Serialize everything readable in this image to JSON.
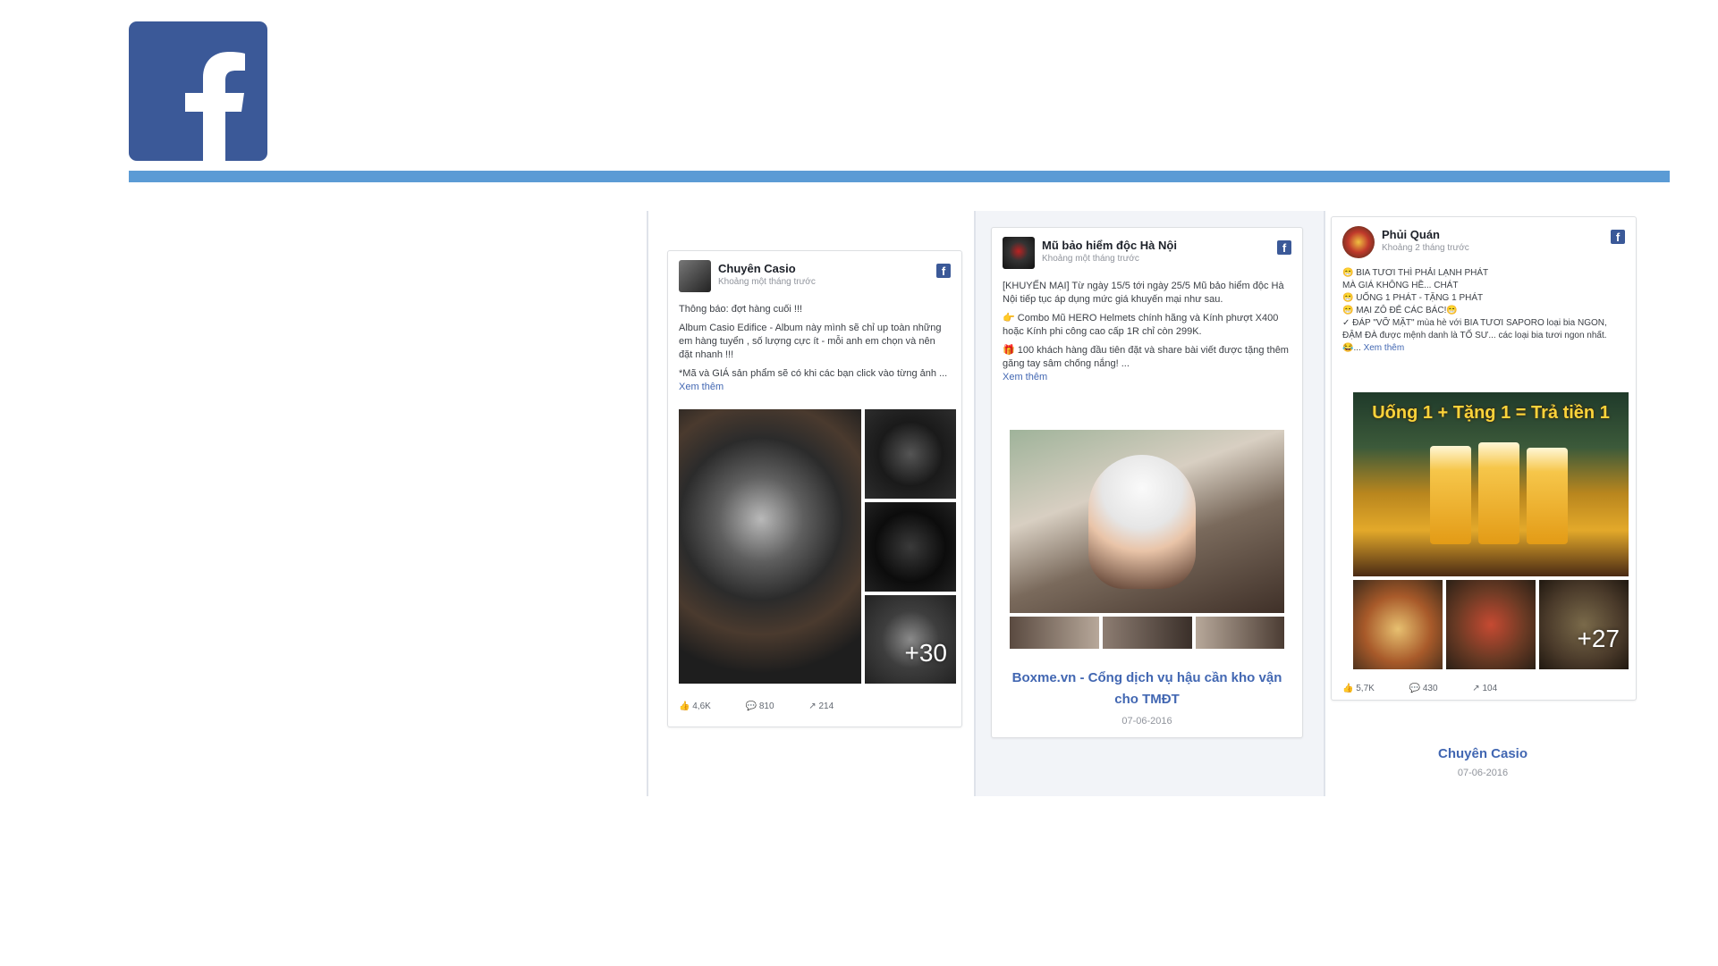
{
  "slide": {
    "logo_letter": "f",
    "colors": {
      "facebook_blue": "#3b5998",
      "rule": "#5b9bd5",
      "link": "#4267b2"
    }
  },
  "cards": [
    {
      "page_name": "Chuyên Casio",
      "subtitle": "Khoảng một tháng trước",
      "text": [
        "Thông báo: đợt hàng cuối !!!",
        "Album Casio Edifice - Album này mình sẽ chỉ up toàn những em hàng tuyển , số lượng cực ít - mỗi anh em chọn và nên đặt nhanh !!!",
        "*Mã và GIÁ sản phẩm sẽ có khi các bạn click vào từng ảnh ..."
      ],
      "see_more": "Xem thêm",
      "more_photos": "+30",
      "stats": {
        "likes": "4,6K",
        "comments": "810",
        "shares": "214"
      }
    },
    {
      "page_name": "Mũ bảo hiểm độc Hà Nội",
      "subtitle": "Khoảng một tháng trước",
      "text": [
        "[KHUYẾN MẠI] Từ ngày 15/5 tới ngày 25/5 Mũ bảo hiểm độc Hà Nội tiếp tục áp dụng mức giá khuyến mại như sau.",
        "👉 Combo Mũ HERO Helmets chính hãng và Kính phượt X400 hoặc Kính phi công cao cấp 1R chỉ còn 299K.",
        "🎁 100 khách hàng đầu tiên đặt và share bài viết được tặng thêm găng tay sâm chống nắng! ..."
      ],
      "see_more": "Xem thêm",
      "link_title": "Boxme.vn - Cổng dịch vụ hậu cần kho vận cho TMĐT",
      "link_date": "07-06-2016"
    },
    {
      "page_name": "Phủi Quán",
      "subtitle": "Khoảng 2 tháng trước",
      "text": [
        "😁 BIA TƯƠI THÌ PHẢI LẠNH PHÁT",
        "MÀ GIÁ KHÔNG HỀ... CHÁT",
        "😁 UỐNG 1 PHÁT - TẶNG 1 PHÁT",
        "😁 MẠI ZÔ ĐỂ CÁC BÁC!😁",
        "✓ ĐÁP \"VỠ MẶT\" mùa hè với BIA TƯƠI SAPORO loại bia NGON, ĐẬM ĐÀ được mệnh danh là TỐ SƯ... các loại bia tươi ngon nhất. 😂..."
      ],
      "see_more": "Xem thêm",
      "banner": "Uống 1 + Tặng 1 = Trả tiền 1",
      "more_photos": "+27",
      "stats": {
        "likes": "5,7K",
        "comments": "430",
        "shares": "104"
      },
      "link_title": "Chuyên Casio",
      "link_date": "07-06-2016"
    }
  ]
}
